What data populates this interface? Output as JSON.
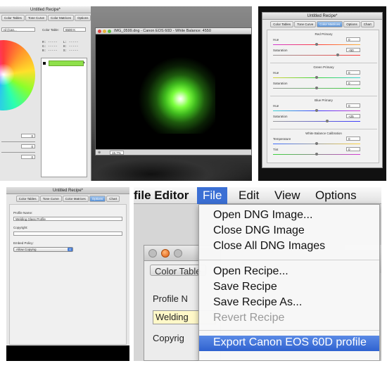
{
  "panel1": {
    "title": "Untitled Recipe*",
    "tabs": [
      "Color Tables",
      "Tone Curve",
      "Color Matrices",
      "Options",
      "Chart"
    ],
    "left_dropdown": "rd (Can...",
    "color_table_label": "Color Table:",
    "color_table_value": "6500 K",
    "readouts": [
      {
        "a": "R:",
        "b": "-----",
        "c": "L:",
        "d": "-----"
      },
      {
        "a": "G:",
        "b": "-----",
        "c": "H:",
        "d": "-----"
      },
      {
        "a": "B:",
        "b": "-----",
        "c": "S:",
        "d": "-----"
      }
    ],
    "values": [
      "0",
      "0",
      "0"
    ]
  },
  "panel2": {
    "title": "IMG_0599.dng - Canon EOS 60D - White Balance: 4550",
    "zoom": "15.7%"
  },
  "panel3": {
    "title": "Untitled Recipe*",
    "tabs": [
      "Color Tables",
      "Tone Curve",
      "Color Matrices",
      "Options",
      "Chart"
    ],
    "groups": [
      {
        "heading": "Red Primary",
        "rows": [
          {
            "label": "Hue",
            "value": "0"
          },
          {
            "label": "Saturation",
            "value": "+50"
          }
        ]
      },
      {
        "heading": "Green Primary",
        "rows": [
          {
            "label": "Hue",
            "value": "0"
          },
          {
            "label": "Saturation",
            "value": "0"
          }
        ]
      },
      {
        "heading": "Blue Primary",
        "rows": [
          {
            "label": "Hue",
            "value": "0"
          },
          {
            "label": "Saturation",
            "value": "+25"
          }
        ]
      },
      {
        "heading": "White Balance Calibration",
        "rows": [
          {
            "label": "Temperature",
            "value": "0"
          },
          {
            "label": "Tint",
            "value": "0"
          }
        ]
      }
    ]
  },
  "panel4": {
    "title": "Untitled Recipe*",
    "tabs": [
      "Color Tables",
      "Tone Curve",
      "Color Matrices",
      "Options",
      "Chart"
    ],
    "profile_name_label": "Profile Name:",
    "profile_name_value": "Welding Glass Profile",
    "copyright_label": "Copyright:",
    "copyright_value": "",
    "embed_policy_label": "Embed Policy:",
    "embed_policy_value": "Allow Copying"
  },
  "panel5": {
    "app_fragment": "file Editor",
    "menubar": [
      "File",
      "Edit",
      "View",
      "Options"
    ],
    "menu_items": [
      {
        "label": "Open DNG Image...",
        "state": "normal"
      },
      {
        "label": "Close DNG Image",
        "state": "normal"
      },
      {
        "label": "Close All DNG Images",
        "state": "normal"
      },
      {
        "label": "Open Recipe...",
        "state": "normal"
      },
      {
        "label": "Save Recipe",
        "state": "normal"
      },
      {
        "label": "Save Recipe As...",
        "state": "normal"
      },
      {
        "label": "Revert Recipe",
        "state": "disabled"
      },
      {
        "label": "Export Canon EOS 60D profile",
        "state": "highlighted"
      }
    ],
    "bg_tab": "Color Table",
    "bg_profile_label": "Profile N",
    "bg_profile_value": "Welding",
    "bg_copyright_label": "Copyrig"
  },
  "colors": {
    "highlight": "#3b6fd4",
    "green_swatch": "#8ee04a",
    "disabled_text": "#9a9a9a"
  }
}
